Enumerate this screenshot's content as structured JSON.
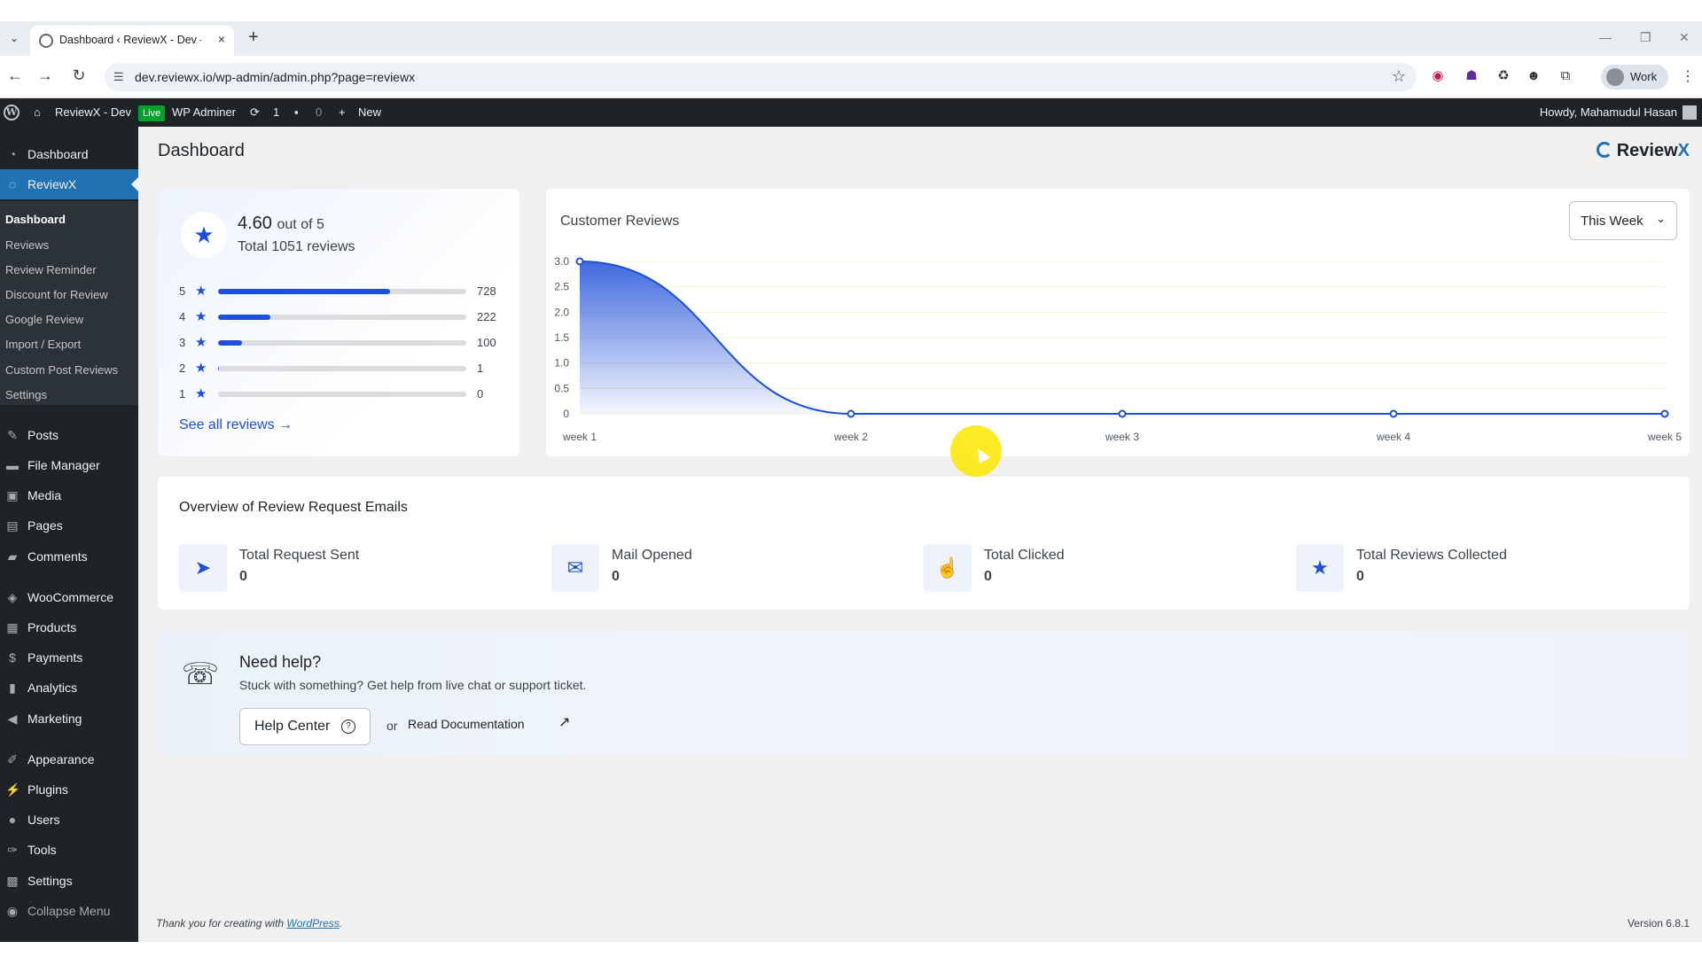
{
  "browser": {
    "tab_title": "Dashboard ‹ ReviewX - Dev — ",
    "tab_close": "×",
    "new_tab": "+",
    "url": "dev.reviewx.io/wp-admin/admin.php?page=reviewx",
    "profile_label": "Work"
  },
  "adminbar": {
    "site_name": "ReviewX - Dev",
    "live_badge": "Live",
    "admin_label": "WP Adminer",
    "updates_count": "1",
    "comments_count": "0",
    "new_label": "New",
    "howdy": "Howdy, Mahamudul Hasan"
  },
  "sidebar": {
    "top_items": [
      {
        "label": "Dashboard",
        "icon": "dashboard-icon"
      },
      {
        "label": "ReviewX",
        "icon": "reviewx-icon"
      }
    ],
    "submenu": [
      "Dashboard",
      "Reviews",
      "Review Reminder",
      "Discount for Review",
      "Google Review",
      "Import / Export",
      "Custom Post Reviews",
      "Settings"
    ],
    "items": [
      {
        "label": "Posts",
        "icon": "pin-icon"
      },
      {
        "label": "File Manager",
        "icon": "folder-icon"
      },
      {
        "label": "Media",
        "icon": "media-icon"
      },
      {
        "label": "Pages",
        "icon": "pages-icon"
      },
      {
        "label": "Comments",
        "icon": "comment-icon"
      },
      {
        "label": "WooCommerce",
        "icon": "woo-icon"
      },
      {
        "label": "Products",
        "icon": "archive-icon"
      },
      {
        "label": "Payments",
        "icon": "payment-icon"
      },
      {
        "label": "Analytics",
        "icon": "chart-bar-icon"
      },
      {
        "label": "Marketing",
        "icon": "megaphone-icon"
      },
      {
        "label": "Appearance",
        "icon": "brush-icon"
      },
      {
        "label": "Plugins",
        "icon": "plug-icon"
      },
      {
        "label": "Users",
        "icon": "user-icon"
      },
      {
        "label": "Tools",
        "icon": "wrench-icon"
      },
      {
        "label": "Settings",
        "icon": "settings-icon"
      },
      {
        "label": "Collapse Menu",
        "icon": "collapse-icon"
      }
    ]
  },
  "page": {
    "title": "Dashboard",
    "brand_name": "Review",
    "brand_x": "X"
  },
  "rating": {
    "average": "4.60",
    "out_of": "out of 5",
    "total": "Total 1051 reviews",
    "bars": [
      {
        "stars": "5",
        "count": "728",
        "fraction": 0.693
      },
      {
        "stars": "4",
        "count": "222",
        "fraction": 0.211
      },
      {
        "stars": "3",
        "count": "100",
        "fraction": 0.095
      },
      {
        "stars": "2",
        "count": "1",
        "fraction": 0.001
      },
      {
        "stars": "1",
        "count": "0",
        "fraction": 0
      }
    ],
    "see_all": "See all reviews →"
  },
  "customer_reviews": {
    "title": "Customer Reviews",
    "range": "This Week",
    "chevron": "⌄"
  },
  "chart_data": {
    "type": "area",
    "categories": [
      "week 1",
      "week 2",
      "week 3",
      "week 4",
      "week 5"
    ],
    "values": [
      3.0,
      0,
      0,
      0,
      0
    ],
    "ylim": [
      0,
      3.0
    ],
    "yticks": [
      "0",
      "0.5",
      "1.0",
      "1.5",
      "2.0",
      "2.5",
      "3.0"
    ],
    "grid": true,
    "color": "#1e4fd8"
  },
  "overview": {
    "title": "Overview of Review Request Emails",
    "stats": [
      {
        "label": "Total Request Sent",
        "value": "0",
        "icon": "send-icon"
      },
      {
        "label": "Mail Opened",
        "value": "0",
        "icon": "mail-open-icon"
      },
      {
        "label": "Total Clicked",
        "value": "0",
        "icon": "click-icon"
      },
      {
        "label": "Total Reviews Collected",
        "value": "0",
        "icon": "star-icon"
      }
    ]
  },
  "help": {
    "title": "Need help?",
    "subtitle": "Stuck with something? Get help from live chat or support ticket.",
    "help_center": "Help Center",
    "or": "or",
    "read_docs": "Read Documentation"
  },
  "footer": {
    "thanks_prefix": "Thank you for creating with",
    "wordpress": "WordPress",
    "thanks_suffix": ".",
    "version": "Version 6.8.1"
  }
}
